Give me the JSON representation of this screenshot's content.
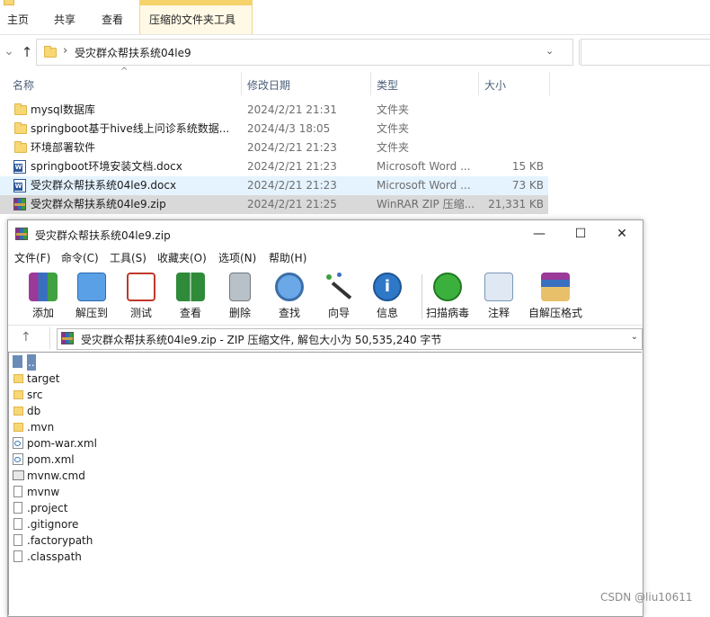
{
  "ribbon": {
    "tabs": [
      "主页",
      "共享",
      "查看"
    ],
    "context_tab": "压缩的文件夹工具"
  },
  "address": {
    "path": "受灾群众帮扶系统04le9"
  },
  "explorer": {
    "columns": {
      "name": "名称",
      "date": "修改日期",
      "type": "类型",
      "size": "大小"
    },
    "files": [
      {
        "name": "mysql数据库",
        "date": "2024/2/21 21:31",
        "type": "文件夹",
        "size": "",
        "icon": "folder-icon"
      },
      {
        "name": "springboot基于hive线上问诊系统数据...",
        "date": "2024/4/3 18:05",
        "type": "文件夹",
        "size": "",
        "icon": "folder-icon"
      },
      {
        "name": "环境部署软件",
        "date": "2024/2/21 21:23",
        "type": "文件夹",
        "size": "",
        "icon": "folder-icon"
      },
      {
        "name": "springboot环境安装文档.docx",
        "date": "2024/2/21 21:23",
        "type": "Microsoft Word ...",
        "size": "15 KB",
        "icon": "word-doc-icon"
      },
      {
        "name": "受灾群众帮扶系统04le9.docx",
        "date": "2024/2/21 21:23",
        "type": "Microsoft Word ...",
        "size": "73 KB",
        "icon": "word-doc-icon"
      },
      {
        "name": "受灾群众帮扶系统04le9.zip",
        "date": "2024/2/21 21:25",
        "type": "WinRAR ZIP 压缩...",
        "size": "21,331 KB",
        "icon": "winrar-archive-icon"
      }
    ]
  },
  "winrar": {
    "title": "受灾群众帮扶系统04le9.zip",
    "menu": [
      "文件(F)",
      "命令(C)",
      "工具(S)",
      "收藏夹(O)",
      "选项(N)",
      "帮助(H)"
    ],
    "toolbar": [
      "添加",
      "解压到",
      "测试",
      "查看",
      "删除",
      "查找",
      "向导",
      "信息",
      "扫描病毒",
      "注释",
      "自解压格式"
    ],
    "path_text": "受灾群众帮扶系统04le9.zip - ZIP 压缩文件, 解包大小为 50,535,240 字节",
    "entries": [
      {
        "name": "..",
        "icon": "parent-folder-icon"
      },
      {
        "name": "target",
        "icon": "folder-icon"
      },
      {
        "name": "src",
        "icon": "folder-icon"
      },
      {
        "name": "db",
        "icon": "folder-icon"
      },
      {
        "name": ".mvn",
        "icon": "folder-icon"
      },
      {
        "name": "pom-war.xml",
        "icon": "xml-file-icon"
      },
      {
        "name": "pom.xml",
        "icon": "xml-file-icon"
      },
      {
        "name": "mvnw.cmd",
        "icon": "cmd-file-icon"
      },
      {
        "name": "mvnw",
        "icon": "file-icon"
      },
      {
        "name": ".project",
        "icon": "file-icon"
      },
      {
        "name": ".gitignore",
        "icon": "file-icon"
      },
      {
        "name": ".factorypath",
        "icon": "file-icon"
      },
      {
        "name": ".classpath",
        "icon": "file-icon"
      }
    ]
  },
  "watermark": "CSDN @liu10611"
}
